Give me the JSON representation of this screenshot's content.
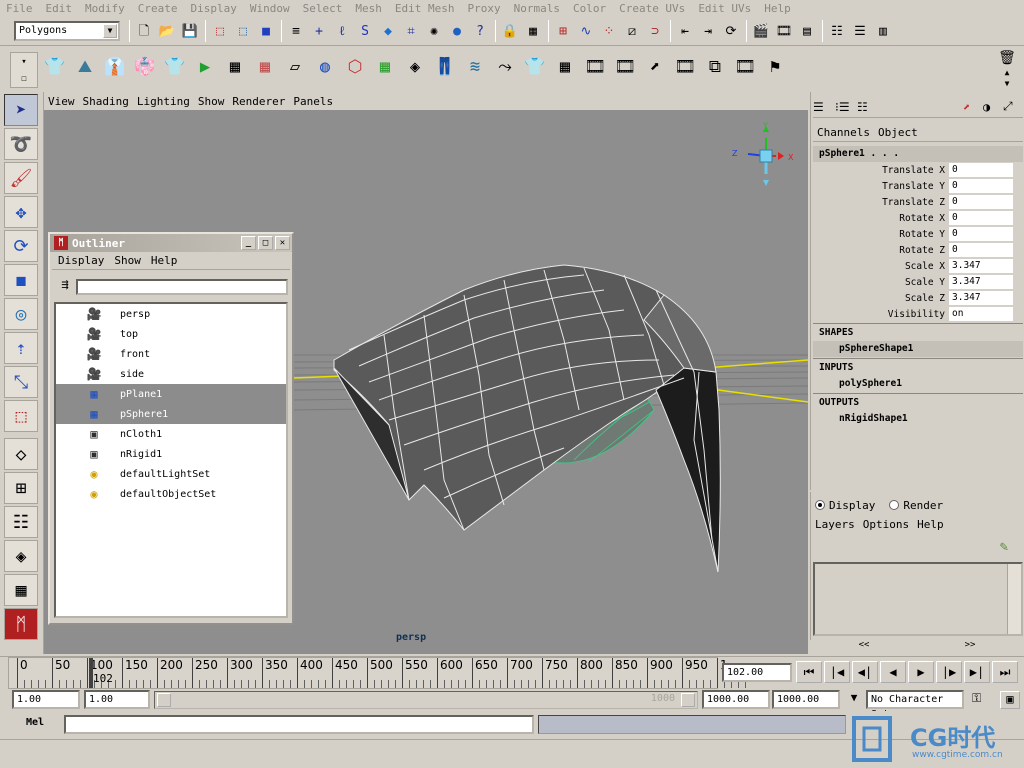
{
  "menubar": [
    "File",
    "Edit",
    "Modify",
    "Create",
    "Display",
    "Window",
    "Select",
    "Mesh",
    "Edit Mesh",
    "Proxy",
    "Normals",
    "Color",
    "Create UVs",
    "Edit UVs",
    "Help"
  ],
  "status": {
    "mode": "Polygons"
  },
  "viewport": {
    "menu": [
      "View",
      "Shading",
      "Lighting",
      "Show",
      "Renderer",
      "Panels"
    ],
    "camera_label": "persp",
    "axis_labels": {
      "x": "X",
      "y": "Y",
      "z": "Z"
    }
  },
  "outliner": {
    "title": "Outliner",
    "menu": [
      "Display",
      "Show",
      "Help"
    ],
    "items": [
      {
        "label": "persp",
        "icon": "camera-icon",
        "selected": false
      },
      {
        "label": "top",
        "icon": "camera-icon",
        "selected": false
      },
      {
        "label": "front",
        "icon": "camera-icon",
        "selected": false
      },
      {
        "label": "side",
        "icon": "camera-icon",
        "selected": false
      },
      {
        "label": "pPlane1",
        "icon": "mesh-icon",
        "selected": true
      },
      {
        "label": "pSphere1",
        "icon": "mesh-icon",
        "selected": true
      },
      {
        "label": "nCloth1",
        "icon": "ncloth-icon",
        "selected": false
      },
      {
        "label": "nRigid1",
        "icon": "nrigid-icon",
        "selected": false
      },
      {
        "label": "defaultLightSet",
        "icon": "set-icon",
        "selected": false
      },
      {
        "label": "defaultObjectSet",
        "icon": "set-icon",
        "selected": false
      }
    ]
  },
  "channel_box": {
    "menu": [
      "Channels",
      "Object"
    ],
    "node": "pSphere1 . . .",
    "attributes": [
      {
        "name": "Translate X",
        "value": "0"
      },
      {
        "name": "Translate Y",
        "value": "0"
      },
      {
        "name": "Translate Z",
        "value": "0"
      },
      {
        "name": "Rotate X",
        "value": "0"
      },
      {
        "name": "Rotate Y",
        "value": "0"
      },
      {
        "name": "Rotate Z",
        "value": "0"
      },
      {
        "name": "Scale X",
        "value": "3.347"
      },
      {
        "name": "Scale Y",
        "value": "3.347"
      },
      {
        "name": "Scale Z",
        "value": "3.347"
      },
      {
        "name": "Visibility",
        "value": "on"
      }
    ],
    "shapes_label": "SHAPES",
    "shapes": [
      "pSphereShape1"
    ],
    "inputs_label": "INPUTS",
    "inputs": [
      "polySphere1"
    ],
    "outputs_label": "OUTPUTS",
    "outputs": [
      "nRigidShape1"
    ]
  },
  "layer_editor": {
    "display_label": "Display",
    "render_label": "Render",
    "menu": [
      "Layers",
      "Options",
      "Help"
    ],
    "scroll_left": "<<",
    "scroll_right": ">>"
  },
  "timeline": {
    "ticks": [
      "0",
      "50",
      "100",
      "150",
      "200",
      "250",
      "300",
      "350",
      "400",
      "450",
      "500",
      "550",
      "600",
      "650",
      "700",
      "750",
      "800",
      "850",
      "900",
      "950",
      "1"
    ],
    "current_frame_marker": "102",
    "current_time": "102.00"
  },
  "range": {
    "start": "1.00",
    "playback_start": "1.00",
    "playback_end": "1000.00",
    "end": "1000.00",
    "slider_end": "1000",
    "character_set": "No Character Set"
  },
  "command": {
    "label": "Mel"
  },
  "watermark": {
    "text": "CG时代",
    "url": "www.cgtime.com.cn"
  }
}
